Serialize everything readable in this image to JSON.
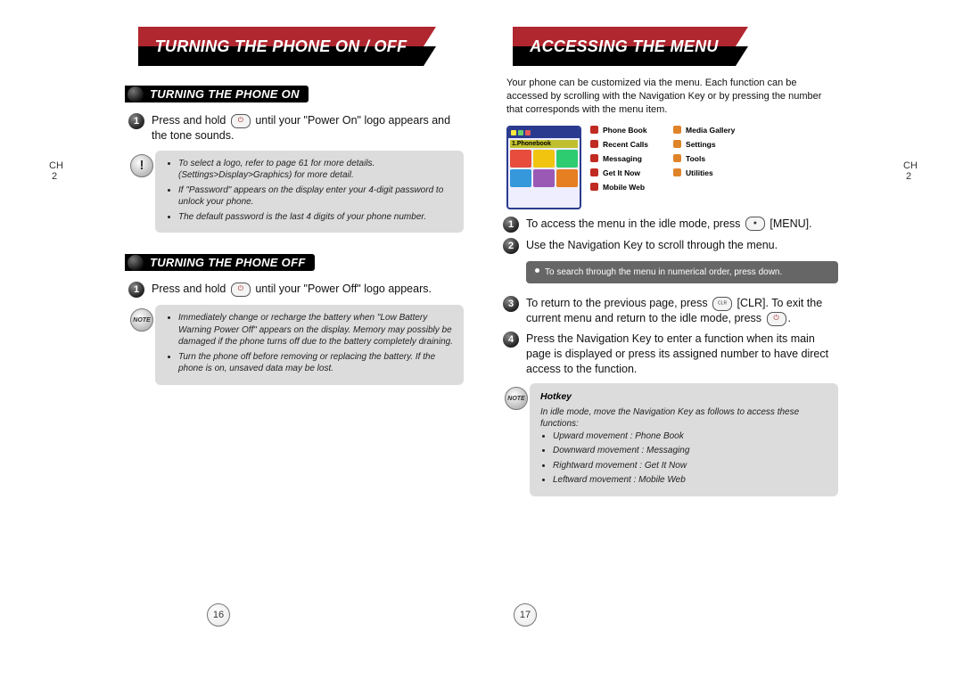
{
  "left": {
    "banner": "TURNING THE PHONE ON / OFF",
    "section_on": {
      "heading": "TURNING THE PHONE ON",
      "step1_a": "Press and hold ",
      "step1_b": " until your \"Power On\" logo appears and the tone sounds.",
      "notes": {
        "n1": "To select a logo, refer to page 61 for more details. (Settings>Display>Graphics) for more detail.",
        "n2": "If \"Password\" appears on the display enter your 4-digit password to unlock your phone.",
        "n3": "The default password is the last 4 digits of your phone number."
      }
    },
    "section_off": {
      "heading": "TURNING THE PHONE OFF",
      "step1_a": "Press and hold ",
      "step1_b": " until your \"Power Off\" logo appears.",
      "notes": {
        "n1": "Immediately change or recharge the battery when \"Low Battery Warning Power Off\" appears on the display. Memory may possibly be damaged if the phone turns off due to the battery completely draining.",
        "n2": "Turn the phone off before removing or replacing the battery. If the phone is on, unsaved data may be lost."
      }
    },
    "ch": "CH",
    "chnum": "2",
    "pagenum": "16"
  },
  "right": {
    "banner": "ACCESSING THE MENU",
    "intro": "Your phone can be customized via the menu. Each function can be accessed by scrolling with the Navigation Key or by pressing the number that corresponds with the menu item.",
    "screen_label": "1.Phonebook",
    "menu": {
      "c1": {
        "m1": "Phone Book",
        "m2": "Recent Calls",
        "m3": "Messaging",
        "m4": "Get It Now",
        "m5": "Mobile Web"
      },
      "c2": {
        "m1": "Media Gallery",
        "m2": "Settings",
        "m3": "Tools",
        "m4": "Utilities"
      }
    },
    "steps": {
      "s1a": "To access the menu in the idle mode, press ",
      "s1b": " [MENU].",
      "s2": "Use the Navigation Key to scroll through the menu.",
      "tip": "To search through the menu in numerical order, press down.",
      "s3a": "To return to the previous page, press ",
      "s3b": " [CLR]. To exit the current menu and return to the idle mode, press ",
      "s3c": ".",
      "s4": "Press the Navigation Key to enter a function when its main page is displayed or press its assigned number to have direct access to the function."
    },
    "hotkey": {
      "title": "Hotkey",
      "intro": "In idle mode, move the Navigation Key as follows to access these functions:",
      "h1": "Upward movement : Phone Book",
      "h2": "Downward movement : Messaging",
      "h3": "Rightward movement : Get It Now",
      "h4": "Leftward movement : Mobile Web"
    },
    "ch": "CH",
    "chnum": "2",
    "pagenum": "17"
  }
}
